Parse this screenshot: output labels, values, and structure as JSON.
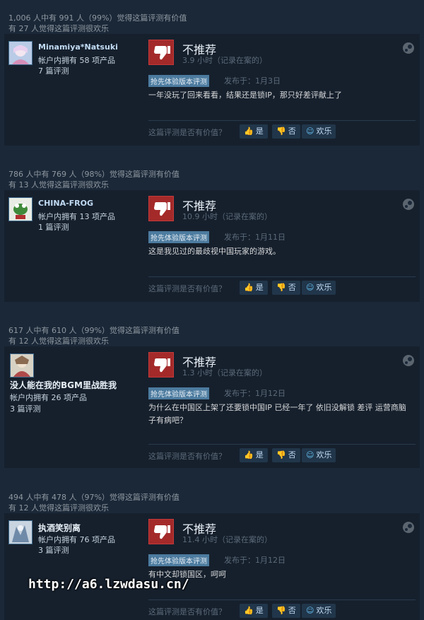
{
  "reviews": [
    {
      "helpful_line1": "1,006 人中有 991 人（99%）觉得这篇评测有价值",
      "helpful_line2": "有 27 人觉得这篇评测很欢乐",
      "user_name": "Minamiya*Natsuki",
      "products": "帐户内拥有 58 项产品",
      "reviews": "7 篇评测",
      "verdict": "不推荐",
      "hours": "3.9 小时（记录在案的）",
      "tag": "抢先体验版本评测",
      "posted": "发布于：1月3日",
      "text": "一年没玩了回来看看，结果还是锁IP，那只好差评献上了"
    },
    {
      "helpful_line1": "786 人中有 769 人（98%）觉得这篇评测有价值",
      "helpful_line2": "有 13 人觉得这篇评测很欢乐",
      "user_name": "CHINA-FROG",
      "products": "帐户内拥有 13 项产品",
      "reviews": "1 篇评测",
      "verdict": "不推荐",
      "hours": "10.9 小时（记录在案的）",
      "tag": "抢先体验版本评测",
      "posted": "发布于：1月11日",
      "text": "这是我见过的最歧视中国玩家的游戏。"
    },
    {
      "helpful_line1": "617 人中有 610 人（99%）觉得这篇评测有价值",
      "helpful_line2": "有 12 人觉得这篇评测很欢乐",
      "user_name": "没人能在我的BGM里战胜我",
      "products": "帐户内拥有 26 项产品",
      "reviews": "3 篇评测",
      "verdict": "不推荐",
      "hours": "1.3 小时（记录在案的）",
      "tag": "抢先体验版本评测",
      "posted": "发布于：1月12日",
      "text": "为什么在中国区上架了还要锁中国IP 已经一年了 依旧没解锁 差评 运营商脑子有病吧？"
    },
    {
      "helpful_line1": "494 人中有 478 人（97%）觉得这篇评测有价值",
      "helpful_line2": "有 12 人觉得这篇评测很欢乐",
      "user_name": "执酒笑别离",
      "products": "帐户内拥有 76 项产品",
      "reviews": "3 篇评测",
      "verdict": "不推荐",
      "hours": "11.4 小时（记录在案的）",
      "tag": "抢先体验版本评测",
      "posted": "发布于：1月12日",
      "text": "有中文却锁国区，呵呵"
    }
  ],
  "vote": {
    "ask": "这篇评测是否有价值？",
    "yes": "是",
    "no": "否",
    "funny": "欢乐"
  },
  "icons": {
    "thumb": "thumbs-down-icon",
    "platform": "steam-icon",
    "yes": "thumbs-up-icon",
    "no": "thumbs-down-icon",
    "funny": "smiley-icon"
  },
  "colors": {
    "background": "#1b2838",
    "card": "#16202d",
    "negative": "#a42a2a",
    "tag": "#4c7b9f",
    "accent": "#66c0f4"
  },
  "watermark": "http://a6.lzwdasu.cn/"
}
